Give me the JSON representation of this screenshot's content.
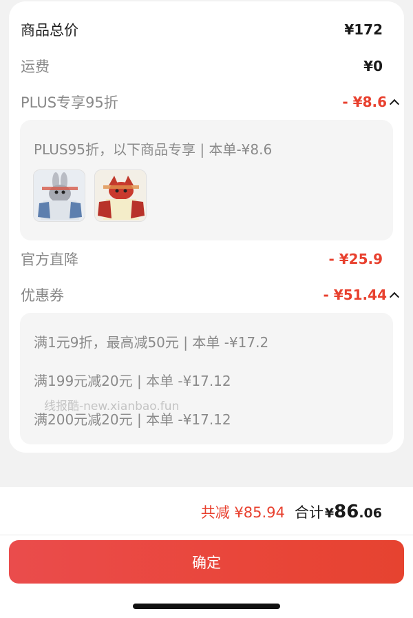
{
  "summary": {
    "goods_total_label": "商品总价",
    "goods_total_value": "¥172",
    "shipping_label": "运费",
    "shipping_value": "¥0",
    "plus_label": "PLUS专享95折",
    "plus_value": "- ¥8.6",
    "official_label": "官方直降",
    "official_value": "- ¥25.9",
    "coupon_label": "优惠券",
    "coupon_value": "- ¥51.44"
  },
  "plus_panel": {
    "text": "PLUS95折，以下商品专享 | 本单-¥8.6",
    "products": [
      {
        "name": "bunny-hoodie"
      },
      {
        "name": "fox-hoodie"
      }
    ]
  },
  "coupon_panel": {
    "lines": [
      "满1元9折，最高减50元 | 本单 -¥17.2",
      "满199元减20元 | 本单 -¥17.12",
      "满200元减20元 | 本单 -¥17.12"
    ]
  },
  "watermark": "线报酷-new.xianbao.fun",
  "footer": {
    "saved_text": "共减 ¥85.94",
    "total_label": "合计",
    "total_currency": "¥",
    "total_integer": "86",
    "total_decimal": ".06",
    "confirm_label": "确定"
  },
  "colors": {
    "accent_red": "#e8402e",
    "button_gradient_start": "#ea4c4c",
    "button_gradient_end": "#e64330"
  }
}
